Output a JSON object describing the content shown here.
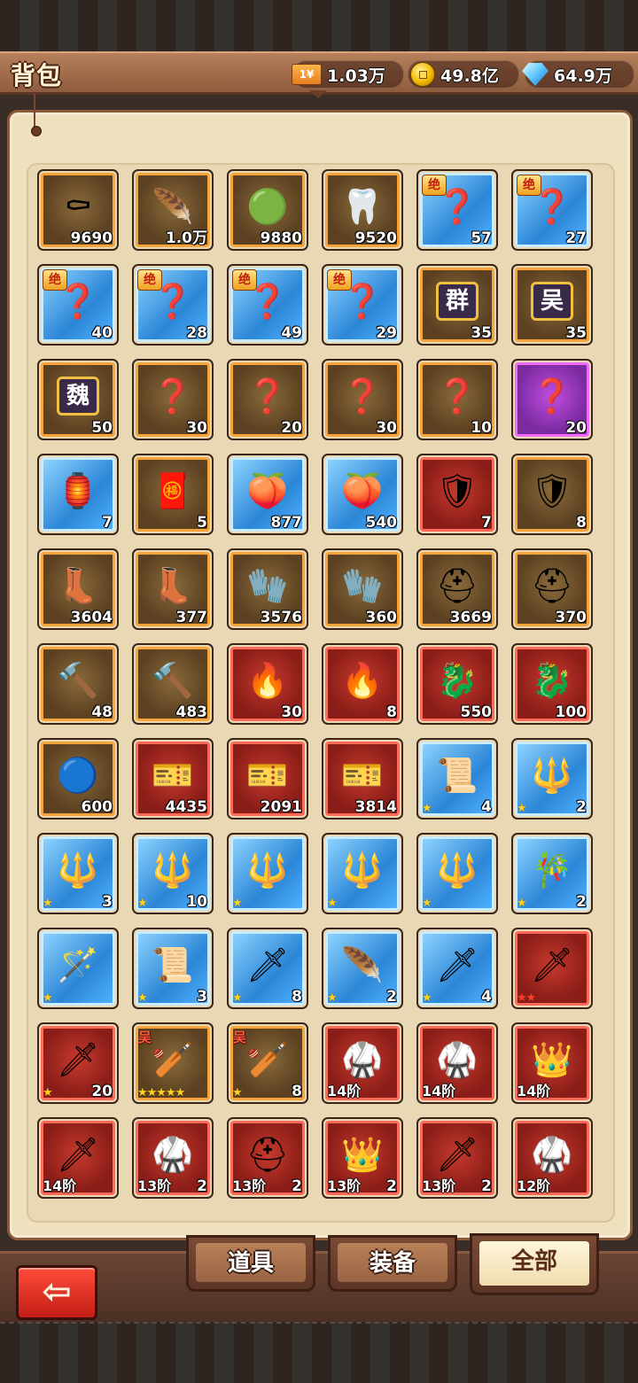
{
  "header": {
    "title": "背包",
    "currencies": [
      {
        "icon": "ticket-icon",
        "icon_text": "1¥",
        "value": "1.03万"
      },
      {
        "icon": "coin-icon",
        "value": "49.8亿"
      },
      {
        "icon": "diamond-icon",
        "value": "64.9万"
      }
    ]
  },
  "tabs": [
    {
      "label": "道具",
      "active": false
    },
    {
      "label": "装备",
      "active": false
    },
    {
      "label": "全部",
      "active": true
    }
  ],
  "back_label": "⇦",
  "items": [
    {
      "icon": "coffin-icon",
      "glyph": "⚰",
      "quality": "orange",
      "count": "9690"
    },
    {
      "icon": "phoenix-feather-icon",
      "glyph": "🪶",
      "quality": "orange",
      "count": "1.0万"
    },
    {
      "icon": "green-orb-icon",
      "glyph": "🟢",
      "quality": "orange",
      "count": "9880"
    },
    {
      "icon": "horn-icon",
      "glyph": "🦷",
      "quality": "orange",
      "count": "9520"
    },
    {
      "icon": "mystery-ring-icon",
      "glyph": "❓",
      "quality": "blue",
      "count": "57",
      "badge": "绝"
    },
    {
      "icon": "mystery-ring-icon",
      "glyph": "❓",
      "quality": "blue",
      "count": "27",
      "badge": "绝"
    },
    {
      "icon": "mystery-ring-icon",
      "glyph": "❓",
      "quality": "blue",
      "count": "40",
      "badge": "绝"
    },
    {
      "icon": "mystery-general-icon",
      "glyph": "❓",
      "quality": "blue",
      "count": "28",
      "badge": "绝"
    },
    {
      "icon": "mystery-general-icon",
      "glyph": "❓",
      "quality": "blue",
      "count": "49",
      "badge": "绝"
    },
    {
      "icon": "mystery-general-icon",
      "glyph": "❓",
      "quality": "blue",
      "count": "29",
      "badge": "绝"
    },
    {
      "icon": "faction-chest-icon",
      "glyph": "群",
      "quality": "orange",
      "count": "35"
    },
    {
      "icon": "faction-chest-icon",
      "glyph": "吴",
      "quality": "orange",
      "count": "35"
    },
    {
      "icon": "faction-chest-icon",
      "glyph": "魏",
      "quality": "orange",
      "count": "50"
    },
    {
      "icon": "mystery-general-icon",
      "glyph": "❓",
      "quality": "orange",
      "count": "30"
    },
    {
      "icon": "mystery-general-icon",
      "glyph": "❓",
      "quality": "orange",
      "count": "20"
    },
    {
      "icon": "mystery-general-icon",
      "glyph": "❓",
      "quality": "orange",
      "count": "30"
    },
    {
      "icon": "mystery-general-icon",
      "glyph": "❓",
      "quality": "orange",
      "count": "10"
    },
    {
      "icon": "mystery-general-icon",
      "glyph": "❓",
      "quality": "purple",
      "count": "20"
    },
    {
      "icon": "fortune-lantern-icon",
      "glyph": "🏮",
      "quality": "blue",
      "count": "7"
    },
    {
      "icon": "gold-token-icon",
      "glyph": "🧧",
      "quality": "orange",
      "count": "5"
    },
    {
      "icon": "peach-orb-icon",
      "glyph": "🍑",
      "quality": "blue",
      "count": "877"
    },
    {
      "icon": "peach-orb-icon",
      "glyph": "🍑",
      "quality": "blue",
      "count": "540"
    },
    {
      "icon": "gold-badge-icon",
      "glyph": "🛡",
      "quality": "red",
      "count": "7"
    },
    {
      "icon": "silver-badge-icon",
      "glyph": "🛡",
      "quality": "orange",
      "count": "8"
    },
    {
      "icon": "boots-icon",
      "glyph": "👢",
      "quality": "orange",
      "count": "3604"
    },
    {
      "icon": "boots-icon",
      "glyph": "👢",
      "quality": "orange",
      "count": "377"
    },
    {
      "icon": "gauntlet-icon",
      "glyph": "🧤",
      "quality": "orange",
      "count": "3576"
    },
    {
      "icon": "gauntlet-icon",
      "glyph": "🧤",
      "quality": "orange",
      "count": "360"
    },
    {
      "icon": "helmet-icon",
      "glyph": "⛑",
      "quality": "orange",
      "count": "3669"
    },
    {
      "icon": "helmet-icon",
      "glyph": "⛑",
      "quality": "orange",
      "count": "370"
    },
    {
      "icon": "hammer-icon",
      "glyph": "🔨",
      "quality": "orange",
      "count": "48"
    },
    {
      "icon": "hammer-icon",
      "glyph": "🔨",
      "quality": "orange",
      "count": "483"
    },
    {
      "icon": "flame-ore-icon",
      "glyph": "🔥",
      "quality": "red",
      "count": "30"
    },
    {
      "icon": "flame-ore-icon",
      "glyph": "🔥",
      "quality": "red",
      "count": "8"
    },
    {
      "icon": "dragon-ring-icon",
      "glyph": "🐉",
      "quality": "red",
      "count": "550"
    },
    {
      "icon": "dragon-ring-icon",
      "glyph": "🐉",
      "quality": "red",
      "count": "100"
    },
    {
      "icon": "blue-orb-icon",
      "glyph": "🔵",
      "quality": "orange",
      "count": "600"
    },
    {
      "icon": "voucher-icon",
      "glyph": "🎫",
      "quality": "red",
      "count": "4435"
    },
    {
      "icon": "voucher-icon",
      "glyph": "🎫",
      "quality": "red",
      "count": "2091"
    },
    {
      "icon": "voucher-icon",
      "glyph": "🎫",
      "quality": "red",
      "count": "3814"
    },
    {
      "icon": "scroll-book-icon",
      "glyph": "📜",
      "quality": "blue",
      "count": "4",
      "stars": "★"
    },
    {
      "icon": "halberd-icon",
      "glyph": "🔱",
      "quality": "blue",
      "count": "2",
      "stars": "★"
    },
    {
      "icon": "halberd-icon",
      "glyph": "🔱",
      "quality": "blue",
      "count": "3",
      "stars": "★"
    },
    {
      "icon": "halberd-icon",
      "glyph": "🔱",
      "quality": "blue",
      "count": "10",
      "stars": "★"
    },
    {
      "icon": "halberd-icon",
      "glyph": "🔱",
      "quality": "blue",
      "count": "",
      "stars": "★"
    },
    {
      "icon": "halberd-icon",
      "glyph": "🔱",
      "quality": "blue",
      "count": "",
      "stars": "★"
    },
    {
      "icon": "halberd-icon",
      "glyph": "🔱",
      "quality": "blue",
      "count": "",
      "stars": "★"
    },
    {
      "icon": "flute-icon",
      "glyph": "🎋",
      "quality": "blue",
      "count": "2",
      "stars": "★"
    },
    {
      "icon": "staff-icon",
      "glyph": "🪄",
      "quality": "blue",
      "count": "",
      "stars": "★"
    },
    {
      "icon": "scroll-icon",
      "glyph": "📜",
      "quality": "blue",
      "count": "3",
      "stars": "★"
    },
    {
      "icon": "spear-icon",
      "glyph": "🗡",
      "quality": "blue",
      "count": "8",
      "stars": "★"
    },
    {
      "icon": "feather-fan-icon",
      "glyph": "🪶",
      "quality": "blue",
      "count": "2",
      "stars": "★"
    },
    {
      "icon": "blade-icon",
      "glyph": "🗡",
      "quality": "blue",
      "count": "4",
      "stars": "★"
    },
    {
      "icon": "jade-sword-icon",
      "glyph": "🗡",
      "quality": "red",
      "count": "",
      "stars": "★★",
      "stars_red": true
    },
    {
      "icon": "jade-sword-icon",
      "glyph": "🗡",
      "quality": "red",
      "count": "20",
      "stars": "★"
    },
    {
      "icon": "spiked-club-icon",
      "glyph": "🏏",
      "quality": "orange",
      "count": "",
      "stars": "★★★★★",
      "tag": "吴"
    },
    {
      "icon": "spiked-club-icon",
      "glyph": "🏏",
      "quality": "orange",
      "count": "8",
      "stars": "★",
      "tag": "吴"
    },
    {
      "icon": "armor-icon",
      "glyph": "🥋",
      "quality": "red",
      "tier": "14阶"
    },
    {
      "icon": "armor-icon",
      "glyph": "🥋",
      "quality": "red",
      "tier": "14阶"
    },
    {
      "icon": "crown-icon",
      "glyph": "👑",
      "quality": "red",
      "tier": "14阶"
    },
    {
      "icon": "golden-sword-icon",
      "glyph": "🗡",
      "quality": "red",
      "tier": "14阶"
    },
    {
      "icon": "jade-armor-icon",
      "glyph": "🥋",
      "quality": "red",
      "tier": "13阶",
      "count": "2"
    },
    {
      "icon": "jade-helmet-icon",
      "glyph": "⛑",
      "quality": "red",
      "tier": "13阶",
      "count": "2"
    },
    {
      "icon": "jade-crown-icon",
      "glyph": "👑",
      "quality": "red",
      "tier": "13阶",
      "count": "2"
    },
    {
      "icon": "jade-sword-icon",
      "glyph": "🗡",
      "quality": "red",
      "tier": "13阶",
      "count": "2"
    },
    {
      "icon": "fire-armor-icon",
      "glyph": "🥋",
      "quality": "red",
      "tier": "12阶"
    }
  ]
}
